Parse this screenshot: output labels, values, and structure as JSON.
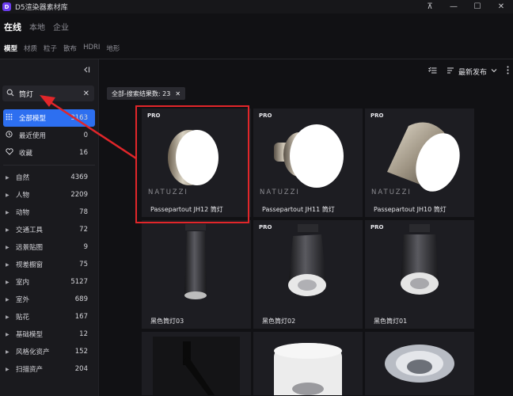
{
  "app": {
    "title": "D5渲染器素材库",
    "logo_letter": "D"
  },
  "window_controls": {
    "pin": "⊼",
    "minimize": "—",
    "maximize": "☐",
    "close": "✕"
  },
  "source_tabs": [
    {
      "label": "在线",
      "active": true
    },
    {
      "label": "本地",
      "active": false
    },
    {
      "label": "企业",
      "active": false
    }
  ],
  "type_tabs": [
    {
      "label": "模型",
      "active": true
    },
    {
      "label": "材质",
      "active": false
    },
    {
      "label": "粒子",
      "active": false
    },
    {
      "label": "散布",
      "active": false
    },
    {
      "label": "HDRI",
      "active": false
    },
    {
      "label": "地形",
      "active": false
    }
  ],
  "search": {
    "value": "筒灯",
    "placeholder": ""
  },
  "sidebar": {
    "pinned": [
      {
        "label": "全部模型",
        "count": "3163",
        "icon": "grid-icon",
        "active": true
      },
      {
        "label": "最近使用",
        "count": "0",
        "icon": "clock-icon",
        "active": false
      },
      {
        "label": "收藏",
        "count": "16",
        "icon": "heart-icon",
        "active": false
      }
    ],
    "categories": [
      {
        "label": "自然",
        "count": "4369"
      },
      {
        "label": "人物",
        "count": "2209"
      },
      {
        "label": "动物",
        "count": "78"
      },
      {
        "label": "交通工具",
        "count": "72"
      },
      {
        "label": "远景贴图",
        "count": "9"
      },
      {
        "label": "视差橱窗",
        "count": "75"
      },
      {
        "label": "室内",
        "count": "5127"
      },
      {
        "label": "室外",
        "count": "689"
      },
      {
        "label": "贴花",
        "count": "167"
      },
      {
        "label": "基础模型",
        "count": "12"
      },
      {
        "label": "风格化资产",
        "count": "152"
      },
      {
        "label": "扫描资产",
        "count": "204"
      }
    ]
  },
  "toolbar": {
    "sort_label": "最新发布"
  },
  "filter_chip": {
    "label": "全部-搜索结果数: 23"
  },
  "cards": [
    {
      "name": "Passepartout JH12 筒灯",
      "badge": "PRO",
      "brand": "NATUZZI"
    },
    {
      "name": "Passepartout JH11 筒灯",
      "badge": "PRO",
      "brand": "NATUZZI"
    },
    {
      "name": "Passepartout JH10 筒灯",
      "badge": "PRO",
      "brand": "NATUZZI"
    },
    {
      "name": "黑色筒灯03",
      "badge": "",
      "brand": ""
    },
    {
      "name": "黑色筒灯02",
      "badge": "PRO",
      "brand": ""
    },
    {
      "name": "黑色筒灯01",
      "badge": "PRO",
      "brand": ""
    },
    {
      "name": "",
      "badge": "",
      "brand": ""
    },
    {
      "name": "",
      "badge": "",
      "brand": ""
    },
    {
      "name": "",
      "badge": "",
      "brand": ""
    }
  ],
  "colors": {
    "accent": "#2d6ff0",
    "highlight": "#e1262a",
    "background": "#111114"
  }
}
